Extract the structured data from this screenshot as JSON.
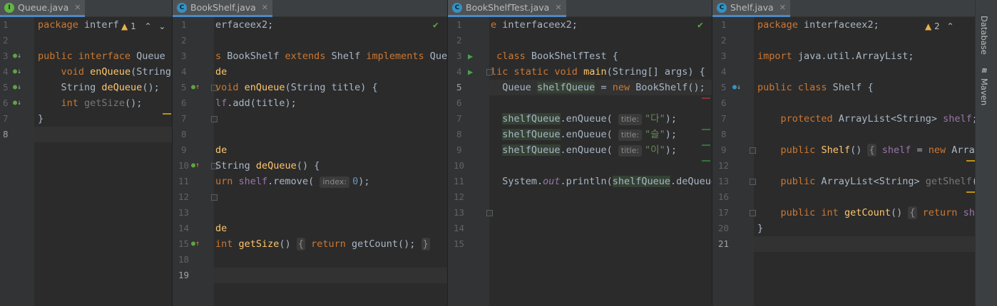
{
  "panes": [
    {
      "tab": "Queue.java",
      "icon": "I",
      "warning_count": "1",
      "lines": [
        "1",
        "2",
        "3",
        "4",
        "5",
        "6",
        "7",
        "8"
      ],
      "current_line": "8"
    },
    {
      "tab": "BookShelf.java",
      "icon": "C",
      "lines": [
        "1",
        "2",
        "3",
        "4",
        "5",
        "6",
        "7",
        "8",
        "9",
        "10",
        "11",
        "12",
        "13",
        "14",
        "15",
        "18",
        "19"
      ],
      "current_line": "19"
    },
    {
      "tab": "BookShelfTest.java",
      "icon": "C",
      "lines": [
        "1",
        "2",
        "3",
        "4",
        "5",
        "6",
        "7",
        "8",
        "9",
        "10",
        "11",
        "12",
        "13",
        "14",
        "15"
      ],
      "current_line": "5"
    },
    {
      "tab": "Shelf.java",
      "icon": "C",
      "warning_count": "2",
      "lines": [
        "1",
        "2",
        "3",
        "4",
        "5",
        "6",
        "7",
        "8",
        "9",
        "12",
        "13",
        "16",
        "17",
        "20",
        "21"
      ],
      "current_line": "21"
    }
  ],
  "hints": {
    "index": "index:",
    "title": "title:"
  },
  "tool_window_strip": {
    "items": [
      "Database",
      "Maven"
    ],
    "maven_icon": "m"
  },
  "colors": {
    "keyword": "#cc7832",
    "method": "#ffc66d",
    "field": "#9876aa",
    "string": "#6a8759",
    "number": "#6897bb",
    "text": "#a9b7c6",
    "background": "#2b2b2b",
    "gutter": "#313335"
  }
}
